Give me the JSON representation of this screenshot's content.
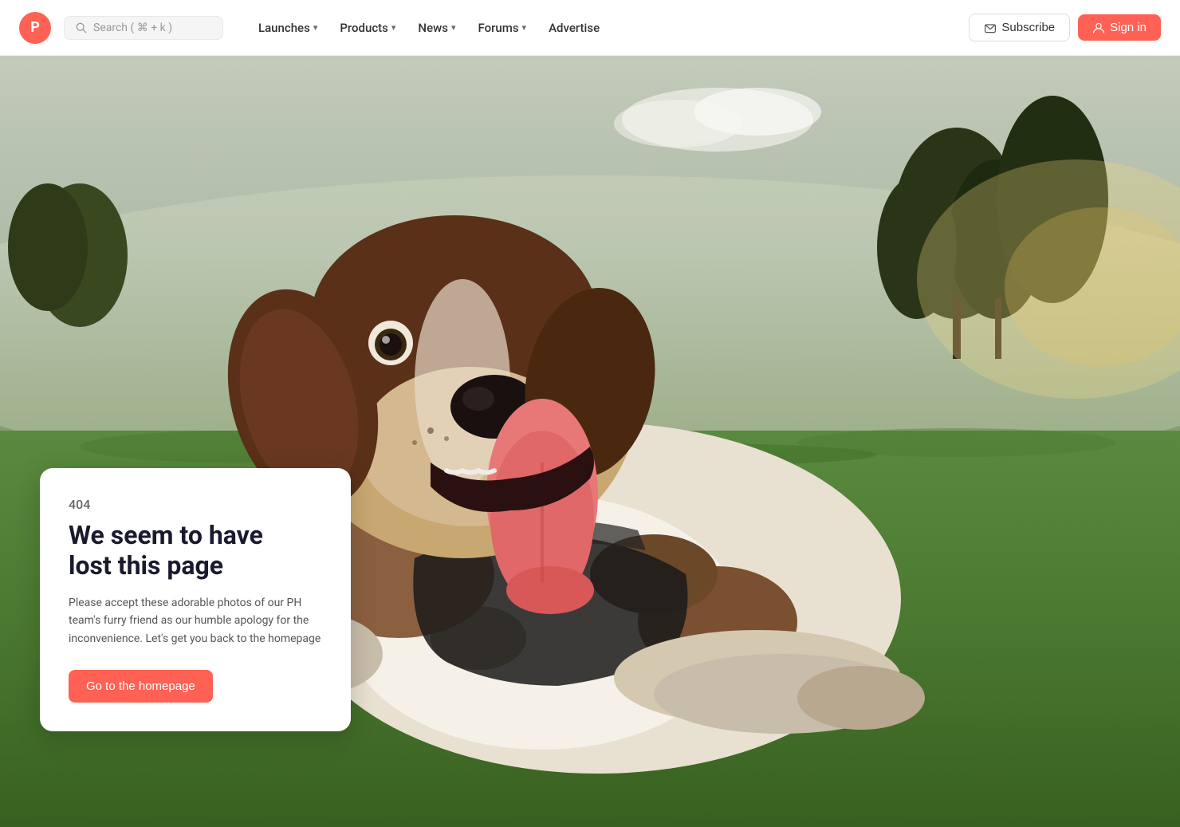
{
  "logo": {
    "letter": "P",
    "color": "#ff6154"
  },
  "search": {
    "placeholder": "Search ( ⌘ + k )"
  },
  "nav": {
    "items": [
      {
        "label": "Launches",
        "hasDropdown": true
      },
      {
        "label": "Products",
        "hasDropdown": true
      },
      {
        "label": "News",
        "hasDropdown": true
      },
      {
        "label": "Forums",
        "hasDropdown": true
      },
      {
        "label": "Advertise",
        "hasDropdown": false
      }
    ],
    "subscribe_label": "Subscribe",
    "signin_label": "Sign in"
  },
  "error": {
    "code": "404",
    "title_line1": "We seem to have",
    "title_line2": "lost this page",
    "description": "Please accept these adorable photos of our PH team's furry friend as our humble apology for the inconvenience. Let's get you back to the homepage",
    "cta_label": "Go to the homepage"
  }
}
